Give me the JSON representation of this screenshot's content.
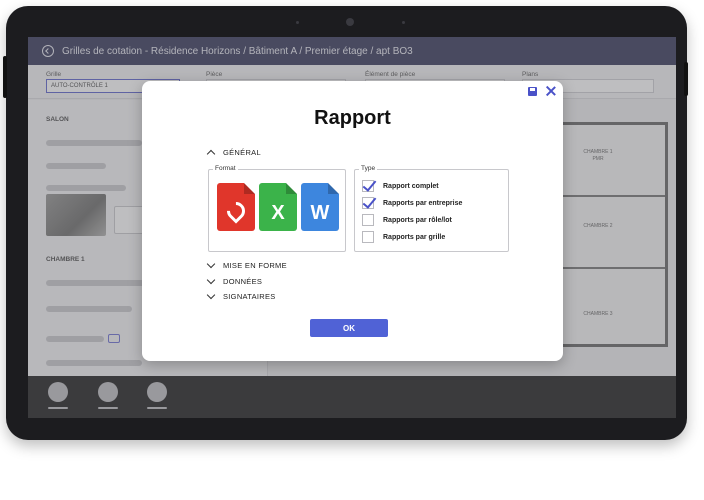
{
  "header": {
    "breadcrumb": "Grilles de cotation - Résidence Horizons / Bâtiment A / Premier étage / apt BO3"
  },
  "fields": {
    "grille": {
      "label": "Grille",
      "value": "AUTO-CONTRÔLE 1"
    },
    "piece": {
      "label": "Pièce",
      "value": ""
    },
    "element": {
      "label": "Élément de pièce",
      "value": ""
    },
    "plans": {
      "label": "Plans",
      "value": ""
    }
  },
  "left_panel": {
    "section_1": "SALON",
    "section_2": "CHAMBRE 1"
  },
  "plan": {
    "rooms": [
      {
        "name": "CHAMBRE 1",
        "sub": "PMR"
      },
      {
        "name": "CHAMBRE 2",
        "sub": ""
      },
      {
        "name": "CHAMBRE 3",
        "sub": ""
      }
    ]
  },
  "modal": {
    "title": "Rapport",
    "sections": {
      "general": "GÉNÉRAL",
      "mise_en_forme": "MISE EN FORME",
      "donnees": "DONNÉES",
      "signataires": "SIGNATAIRES"
    },
    "format": {
      "legend": "Format",
      "items": [
        {
          "name": "pdf-icon",
          "letter": "",
          "color": "#e0362b"
        },
        {
          "name": "excel-icon",
          "letter": "X",
          "color": "#3bb34a"
        },
        {
          "name": "word-icon",
          "letter": "W",
          "color": "#3d86de"
        }
      ]
    },
    "type": {
      "legend": "Type",
      "options": [
        {
          "label": "Rapport complet",
          "checked": true
        },
        {
          "label": "Rapports par entreprise",
          "checked": true
        },
        {
          "label": "Rapports par rôle/lot",
          "checked": false
        },
        {
          "label": "Rapports par grille",
          "checked": false
        }
      ]
    },
    "ok_label": "OK"
  },
  "colors": {
    "accent": "#4a52c8",
    "header_bg": "#1f2148"
  }
}
